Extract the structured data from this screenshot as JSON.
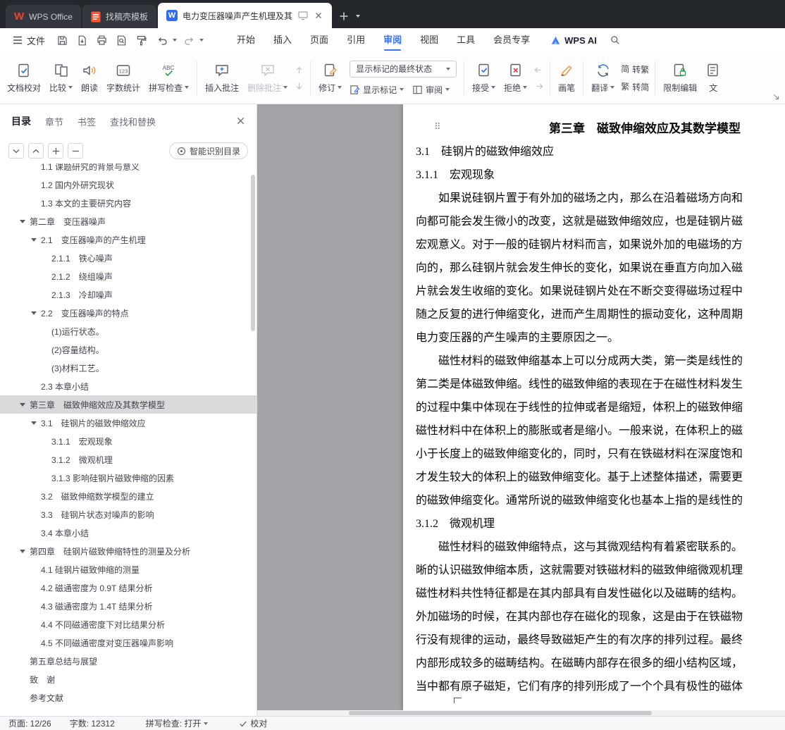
{
  "colors": {
    "accent": "#3b74ec",
    "tabbar_bg": "#24272c",
    "toc_selection_bg": "#d8dadc"
  },
  "icons": {
    "w_letter": "W",
    "drag_handle": "⠿",
    "wordcount_digits": "123",
    "spell_letters": "ABC"
  },
  "tabbar": {
    "wps_tab": "WPS Office",
    "template_tab": "找稿壳模板",
    "doc_tab": "电力变压器噪声产生机理及其"
  },
  "menubar": {
    "file": "文件",
    "items": [
      {
        "label": "开始",
        "cls": ""
      },
      {
        "label": "插入",
        "cls": ""
      },
      {
        "label": "页面",
        "cls": ""
      },
      {
        "label": "引用",
        "cls": ""
      },
      {
        "label": "审阅",
        "cls": "active"
      },
      {
        "label": "视图",
        "cls": ""
      },
      {
        "label": "工具",
        "cls": ""
      },
      {
        "label": "会员专享",
        "cls": ""
      }
    ],
    "wps_ai": "WPS AI"
  },
  "ribbon": {
    "doc_proof": "文档校对",
    "compare": "比较",
    "read_aloud": "朗读",
    "word_count": "字数统计",
    "spell_check": "拼写检查",
    "insert_comment": "插入批注",
    "delete_comment": "删除批注",
    "track_changes": "修订",
    "markup_state": "显示标记的最终状态",
    "show_markup": "显示标记",
    "review_pane": "审阅",
    "accept": "接受",
    "reject": "拒绝",
    "pen": "画笔",
    "translate": "翻译",
    "simp_char": "简",
    "trad_char": "繁",
    "to_trad": "转繁",
    "to_simp": "转简",
    "restrict_edit": "限制编辑",
    "clipped_label": "文"
  },
  "sidebar": {
    "tabs": [
      {
        "label": "目录",
        "cls": "active"
      },
      {
        "label": "章节",
        "cls": ""
      },
      {
        "label": "书签",
        "cls": ""
      },
      {
        "label": "查找和替换",
        "cls": ""
      }
    ],
    "smart_button": "智能识别目录",
    "toc": {
      "items": [
        {
          "label": "1.1 课题研究的背景与意义",
          "cls": "lvl2 clipped"
        },
        {
          "label": "1.2 国内外研究现状",
          "cls": "lvl2"
        },
        {
          "label": "1.3 本文的主要研究内容",
          "cls": "lvl2"
        },
        {
          "label": "第二章　变压器噪声",
          "cls": "lvl1 has-tri"
        },
        {
          "label": "2.1　变压器噪声的产生机理",
          "cls": "lvl2 has-tri"
        },
        {
          "label": "2.1.1　铁心噪声",
          "cls": "lvl3"
        },
        {
          "label": "2.1.2　绕组噪声",
          "cls": "lvl3"
        },
        {
          "label": "2.1.3　冷却噪声",
          "cls": "lvl3"
        },
        {
          "label": "2.2　变压器噪声的特点",
          "cls": "lvl2 has-tri"
        },
        {
          "label": "(1)运行状态。",
          "cls": "lvl3"
        },
        {
          "label": "(2)容量结构。",
          "cls": "lvl3"
        },
        {
          "label": "(3)材料工艺。",
          "cls": "lvl3"
        },
        {
          "label": "2.3 本章小结",
          "cls": "lvl2"
        },
        {
          "label": "第三章　磁致伸缩效应及其数学模型",
          "cls": "lvl1 has-tri selected"
        },
        {
          "label": "3.1　硅钢片的磁致伸缩效应",
          "cls": "lvl2 has-tri"
        },
        {
          "label": "3.1.1　宏观现象",
          "cls": "lvl3"
        },
        {
          "label": "3.1.2　微观机理",
          "cls": "lvl3"
        },
        {
          "label": "3.1.3 影响硅钢片磁致伸缩的因素",
          "cls": "lvl3"
        },
        {
          "label": "3.2　磁致伸缩数学模型的建立",
          "cls": "lvl2"
        },
        {
          "label": "3.3　硅钢片状态对噪声的影响",
          "cls": "lvl2"
        },
        {
          "label": "3.4 本章小结",
          "cls": "lvl2"
        },
        {
          "label": "第四章　硅钢片磁致伸缩特性的测量及分析",
          "cls": "lvl1 has-tri"
        },
        {
          "label": "4.1 硅钢片磁致伸缩的测量",
          "cls": "lvl2"
        },
        {
          "label": "4.2 磁通密度为 0.9T 结果分析",
          "cls": "lvl2"
        },
        {
          "label": "4.3 磁通密度为 1.4T 结果分析",
          "cls": "lvl2"
        },
        {
          "label": "4.4 不同磁通密度下对比结果分析",
          "cls": "lvl2"
        },
        {
          "label": "4.5 不同磁通密度对变压器噪声影响",
          "cls": "lvl2"
        },
        {
          "label": "第五章总结与展望",
          "cls": "lvl1"
        },
        {
          "label": "致　谢",
          "cls": "lvl1"
        },
        {
          "label": "参考文献",
          "cls": "lvl1"
        }
      ]
    }
  },
  "document": {
    "title": "第三章　磁致伸缩效应及其数学模型",
    "h31": "3.1　硅钢片的磁致伸缩效应",
    "h311": "3.1.1　宏观现象",
    "h312": "3.1.2　微观机理",
    "p1": [
      "如果说硅钢片置于有外加的磁场之内，那么在沿着磁场方向和",
      "向都可能会发生微小的改变，这就是磁致伸缩效应，也是硅钢片磁",
      "宏观意义。对于一般的硅钢片材料而言，如果说外加的电磁场的方",
      "向的，那么硅钢片就会发生伸长的变化，如果说在垂直方向加入磁",
      "片就会发生收缩的变化。如果说硅钢片处在不断交变得磁场过程中",
      "随之反复的进行伸缩变化，进而产生周期性的振动变化，这种周期",
      "电力变压器的产生噪声的主要原因之一。"
    ],
    "p2": [
      "磁性材料的磁致伸缩基本上可以分成两大类，第一类是线性的",
      "第二类是体磁致伸缩。线性的磁致伸缩的表现在于在磁性材料发生",
      "的过程中集中体现在于线性的拉伸或者是缩短，体积上的磁致伸缩",
      "磁性材料中在体积上的膨胀或者是缩小。一般来说，在体积上的磁",
      "小于长度上的磁致伸缩变化的，同时，只有在铁磁材料在深度饱和",
      "才发生较大的体积上的磁致伸缩变化。基于上述整体描述，需要更",
      "的磁致伸缩变化。通常所说的磁致伸缩变化也基本上指的是线性的"
    ],
    "p3": [
      "磁性材料的磁致伸缩特点，这与其微观结构有着紧密联系的。",
      "晰的认识磁致伸缩本质，这就需要对铁磁材料的磁致伸缩微观机理",
      "磁性材料共性特征都是在其内部具有自发性磁化以及磁畴的结构。",
      "外加磁场的时候，在其内部也存在磁化的现象，这是由于在铁磁物",
      "行没有规律的运动，最终导致磁矩产生的有次序的排列过程。最终",
      "内部形成较多的磁畴结构。在磁畴内部存在很多的细小结构区域，",
      "当中都有原子磁矩，它们有序的排列形成了一个个具有极性的磁体"
    ]
  },
  "statusbar": {
    "page": "页面: 12/26",
    "words": "字数: 12312",
    "spell": "拼写检查: 打开",
    "proof": "校对"
  }
}
